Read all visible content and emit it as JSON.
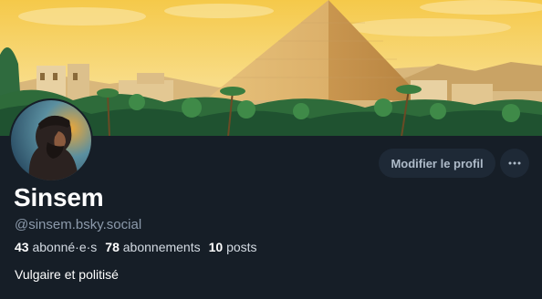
{
  "profile": {
    "display_name": "Sinsem",
    "handle": "@sinsem.bsky.social",
    "bio": "Vulgaire et politisé",
    "stats": {
      "followers_count": "43",
      "followers_label": "abonné·e·s",
      "following_count": "78",
      "following_label": "abonnements",
      "posts_count": "10",
      "posts_label": "posts"
    }
  },
  "actions": {
    "edit_profile_label": "Modifier le profil",
    "more_icon": "ellipsis-icon"
  },
  "colors": {
    "background": "#161e27",
    "button_bg": "#1e2936",
    "button_text": "#aebbc9",
    "handle_text": "#8c9aab"
  }
}
